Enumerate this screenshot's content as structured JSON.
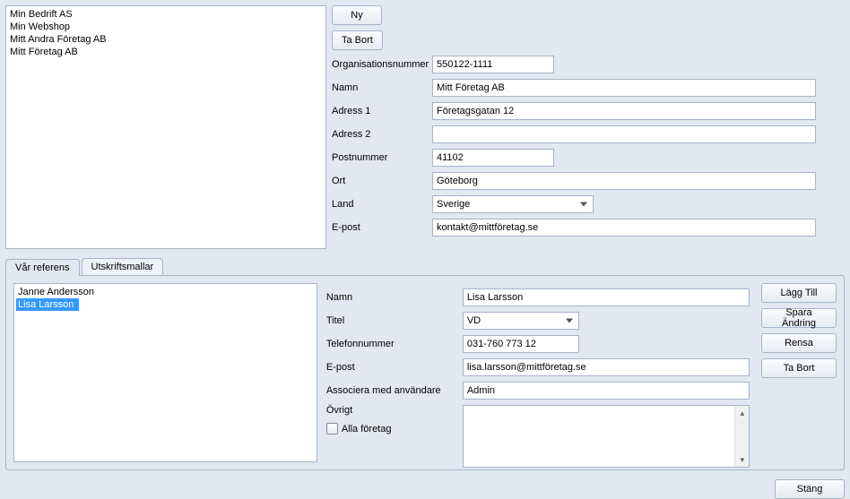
{
  "companies": [
    "Min Bedrift AS",
    "Min Webshop",
    "Mitt Andra Företag AB",
    "Mitt Företag AB"
  ],
  "toolbar": {
    "new": "Ny",
    "delete": "Ta Bort"
  },
  "company_form": {
    "org_label": "Organisationsnummer",
    "org_value": "550122-1111",
    "name_label": "Namn",
    "name_value": "Mitt Företag AB",
    "addr1_label": "Adress 1",
    "addr1_value": "Företagsgatan 12",
    "addr2_label": "Adress 2",
    "addr2_value": "",
    "postal_label": "Postnummer",
    "postal_value": "41102",
    "city_label": "Ort",
    "city_value": "Göteborg",
    "country_label": "Land",
    "country_value": "Sverige",
    "email_label": "E-post",
    "email_value": "kontakt@mittföretag.se"
  },
  "tabs": {
    "ref": "Vår referens",
    "templates": "Utskriftsmallar"
  },
  "references": [
    "Janne Andersson",
    "Lisa Larsson"
  ],
  "ref_selected_index": 1,
  "ref_form": {
    "name_label": "Namn",
    "name_value": "Lisa Larsson",
    "title_label": "Titel",
    "title_value": "VD",
    "phone_label": "Telefonnummer",
    "phone_value": "031-760 773 12",
    "email_label": "E-post",
    "email_value": "lisa.larsson@mittföretag.se",
    "assoc_label": "Associera med användare",
    "assoc_value": "Admin",
    "other_label": "Övrigt",
    "other_value": "",
    "all_companies": "Alla företag"
  },
  "ref_buttons": {
    "add": "Lägg Till",
    "save": "Spara Ändring",
    "clear": "Rensa",
    "delete": "Ta Bort"
  },
  "close": "Stäng"
}
